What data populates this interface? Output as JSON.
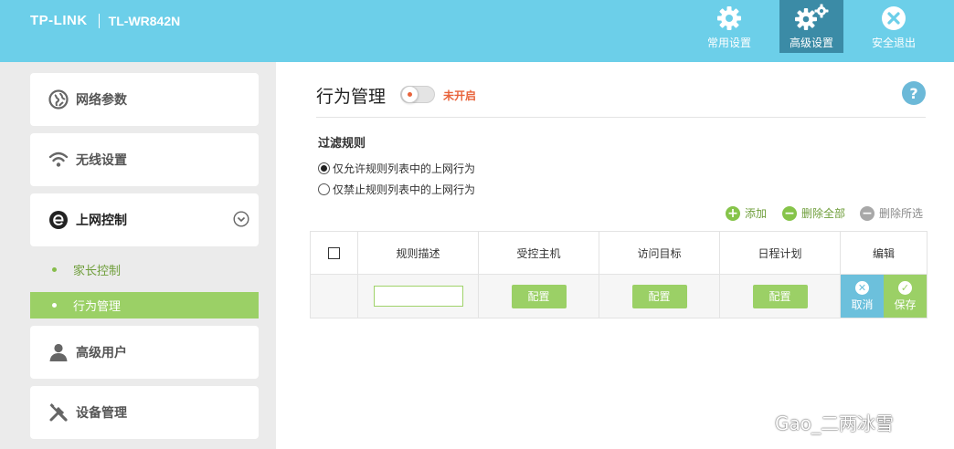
{
  "brand": {
    "logo": "TP-LINK",
    "model": "TL-WR842N"
  },
  "topnav": {
    "common": "常用设置",
    "advanced": "高级设置",
    "logout": "安全退出"
  },
  "sidebar": {
    "items": [
      {
        "label": "网络参数",
        "icon": "globe-icon"
      },
      {
        "label": "无线设置",
        "icon": "wifi-icon"
      },
      {
        "label": "上网控制",
        "icon": "internet-control-icon"
      },
      {
        "label": "高级用户",
        "icon": "user-icon"
      },
      {
        "label": "设备管理",
        "icon": "tools-icon"
      }
    ],
    "submenu": [
      {
        "label": "家长控制"
      },
      {
        "label": "行为管理"
      }
    ]
  },
  "main": {
    "title": "行为管理",
    "toggle_status": "未开启",
    "help": "?",
    "section_title": "过滤规则",
    "radio_allow": "仅允许规则列表中的上网行为",
    "radio_deny": "仅禁止规则列表中的上网行为",
    "actions": {
      "add": "添加",
      "delete_all": "删除全部",
      "delete_selected": "删除所选"
    },
    "table": {
      "headers": [
        "规则描述",
        "受控主机",
        "访问目标",
        "日程计划",
        "编辑"
      ],
      "row": {
        "description": "",
        "config_label": "配置",
        "cancel_label": "取消",
        "save_label": "保存"
      }
    }
  },
  "watermark": {
    "text": "Gao_二两冰雪"
  },
  "colors": {
    "header_bg": "#6ccfe9",
    "nav_active": "#3b8ba6",
    "accent_green": "#9bd066",
    "status_off": "#e8633b",
    "cancel_blue": "#6cc0dc"
  }
}
